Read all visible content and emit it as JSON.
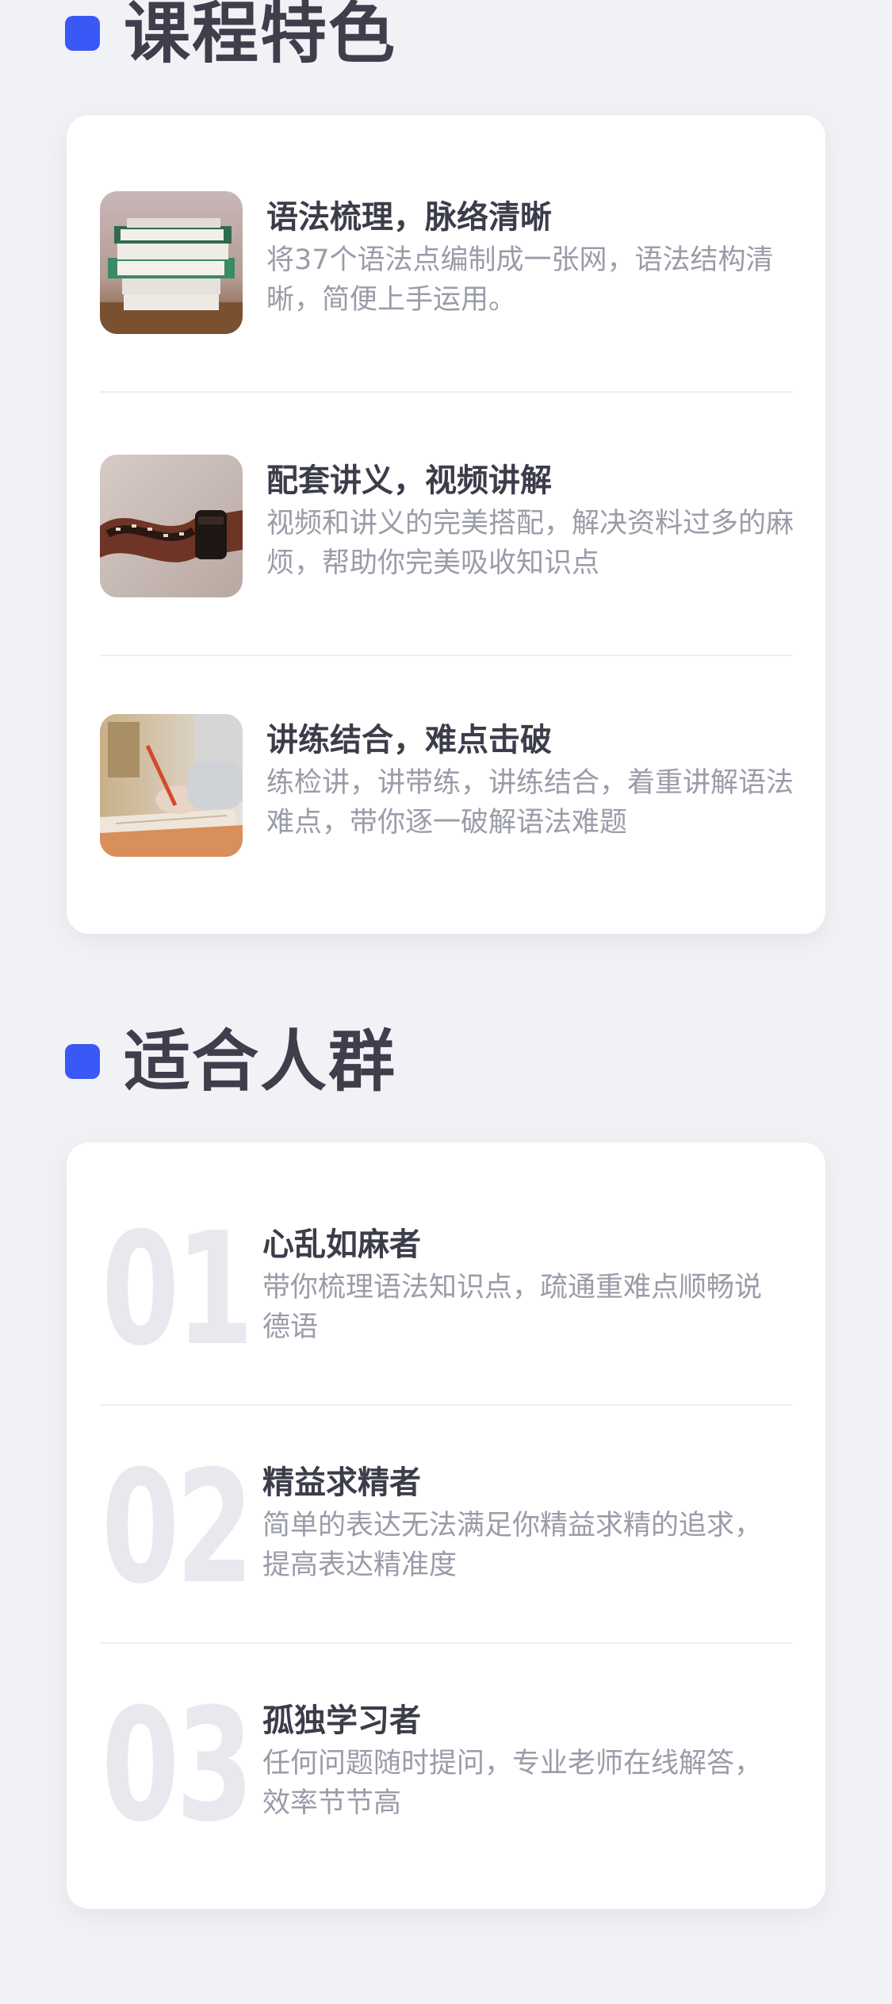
{
  "features_section": {
    "title": "课程特色",
    "items": [
      {
        "title": "语法梳理，脉络清晰",
        "desc": "将37个语法点编制成一张网，语法结构清晰，简便上手运用。",
        "image": "books-stack-photo"
      },
      {
        "title": "配套讲义，视频讲解",
        "desc": "视频和讲义的完美搭配，解决资料过多的麻烦，帮助你完美吸收知识点",
        "image": "film-reel-photo"
      },
      {
        "title": "讲练结合，难点击破",
        "desc": "练检讲，讲带练，讲练结合，着重讲解语法难点，带你逐一破解语法难题",
        "image": "writing-notebook-photo"
      }
    ]
  },
  "audience_section": {
    "title": "适合人群",
    "items": [
      {
        "num": "01",
        "title": "心乱如麻者",
        "desc": "带你梳理语法知识点，疏通重难点顺畅说德语"
      },
      {
        "num": "02",
        "title": "精益求精者",
        "desc": "简单的表达无法满足你精益求精的追求，提高表达精准度"
      },
      {
        "num": "03",
        "title": "孤独学习者",
        "desc": "任何问题随时提问，专业老师在线解答，效率节节高"
      }
    ]
  },
  "colors": {
    "accent": "#3a58f6",
    "background": "#f1f2f5",
    "card": "#ffffff",
    "title": "#3c3d4a",
    "desc": "#9a9ca8",
    "number": "#e8e9ee"
  }
}
